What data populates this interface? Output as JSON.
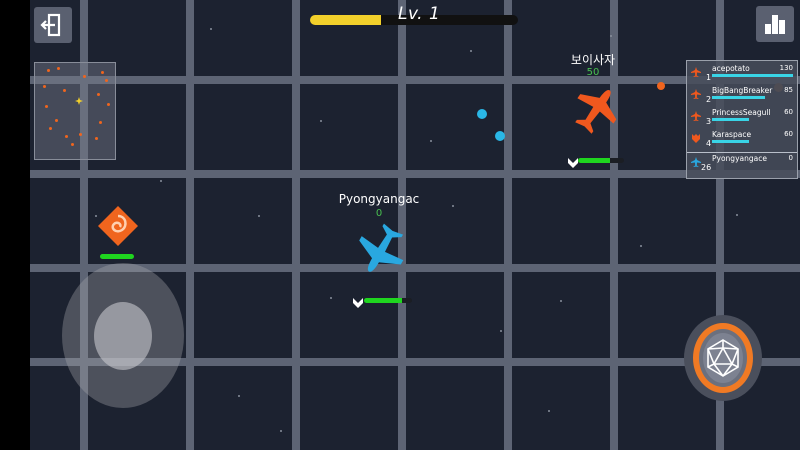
{
  "hud": {
    "level_label": "Lv. 1",
    "xp_progress": 0.34,
    "exit_icon": "exit-door-icon",
    "stats_icon": "bar-chart-icon"
  },
  "player": {
    "name": "Pyongyangac",
    "score": "0",
    "health": 0.8,
    "color": "#29a8e0"
  },
  "enemy": {
    "name": "보이사자",
    "score": "50",
    "health": 0.7,
    "color": "#f0581e"
  },
  "pickup": {
    "icon": "spiral-powerup-icon",
    "health": 1.0,
    "color": "#f0651e"
  },
  "leaderboard": {
    "entries": [
      {
        "rank": "1",
        "name": "acepotato",
        "score": "130",
        "bar": 1.0
      },
      {
        "rank": "2",
        "name": "BigBangBreaker",
        "score": "85",
        "bar": 0.65
      },
      {
        "rank": "3",
        "name": "PrincessSeagull",
        "score": "60",
        "bar": 0.46
      },
      {
        "rank": "4",
        "name": "Karaspace",
        "score": "60",
        "bar": 0.46
      }
    ],
    "self": {
      "rank": "26",
      "name": "Pyongyangace",
      "score": "0",
      "bar": 0.0
    }
  },
  "controls": {
    "joystick_icon": "virtual-joystick",
    "ability_icon": "d20-dice-icon",
    "ability_color": "#f07a24"
  }
}
